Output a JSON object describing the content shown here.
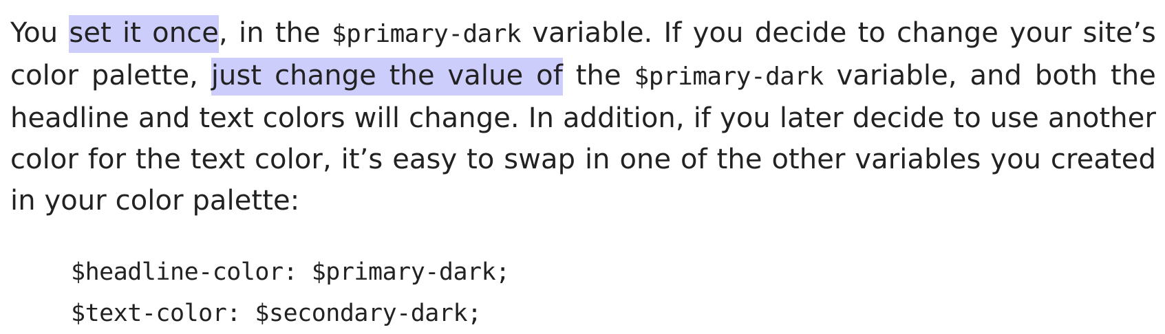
{
  "paragraph": {
    "l1_a": "You ",
    "l1_hl": "set it once",
    "l1_b": ", in the ",
    "l1_code": "$primary-dark",
    "l1_c": " variable. If you decide to change your site’s",
    "l2_a": "color palette, ",
    "l2_hl": "just change the value of",
    "l2_b": " the ",
    "l2_code": "$primary-dark",
    "l2_c": " variable, and both the",
    "l3": "headline and text colors will change. In addition, if you later decide to use another",
    "l4": "color for the text color, it’s easy to swap in one of the other variables you created",
    "l5": "in your color palette:"
  },
  "code_block": {
    "lines": [
      "$headline-color: $primary-dark;",
      "$text-color: $secondary-dark;"
    ]
  },
  "colors": {
    "highlight": "#cdcdfb",
    "text": "#222222",
    "background": "#ffffff"
  }
}
